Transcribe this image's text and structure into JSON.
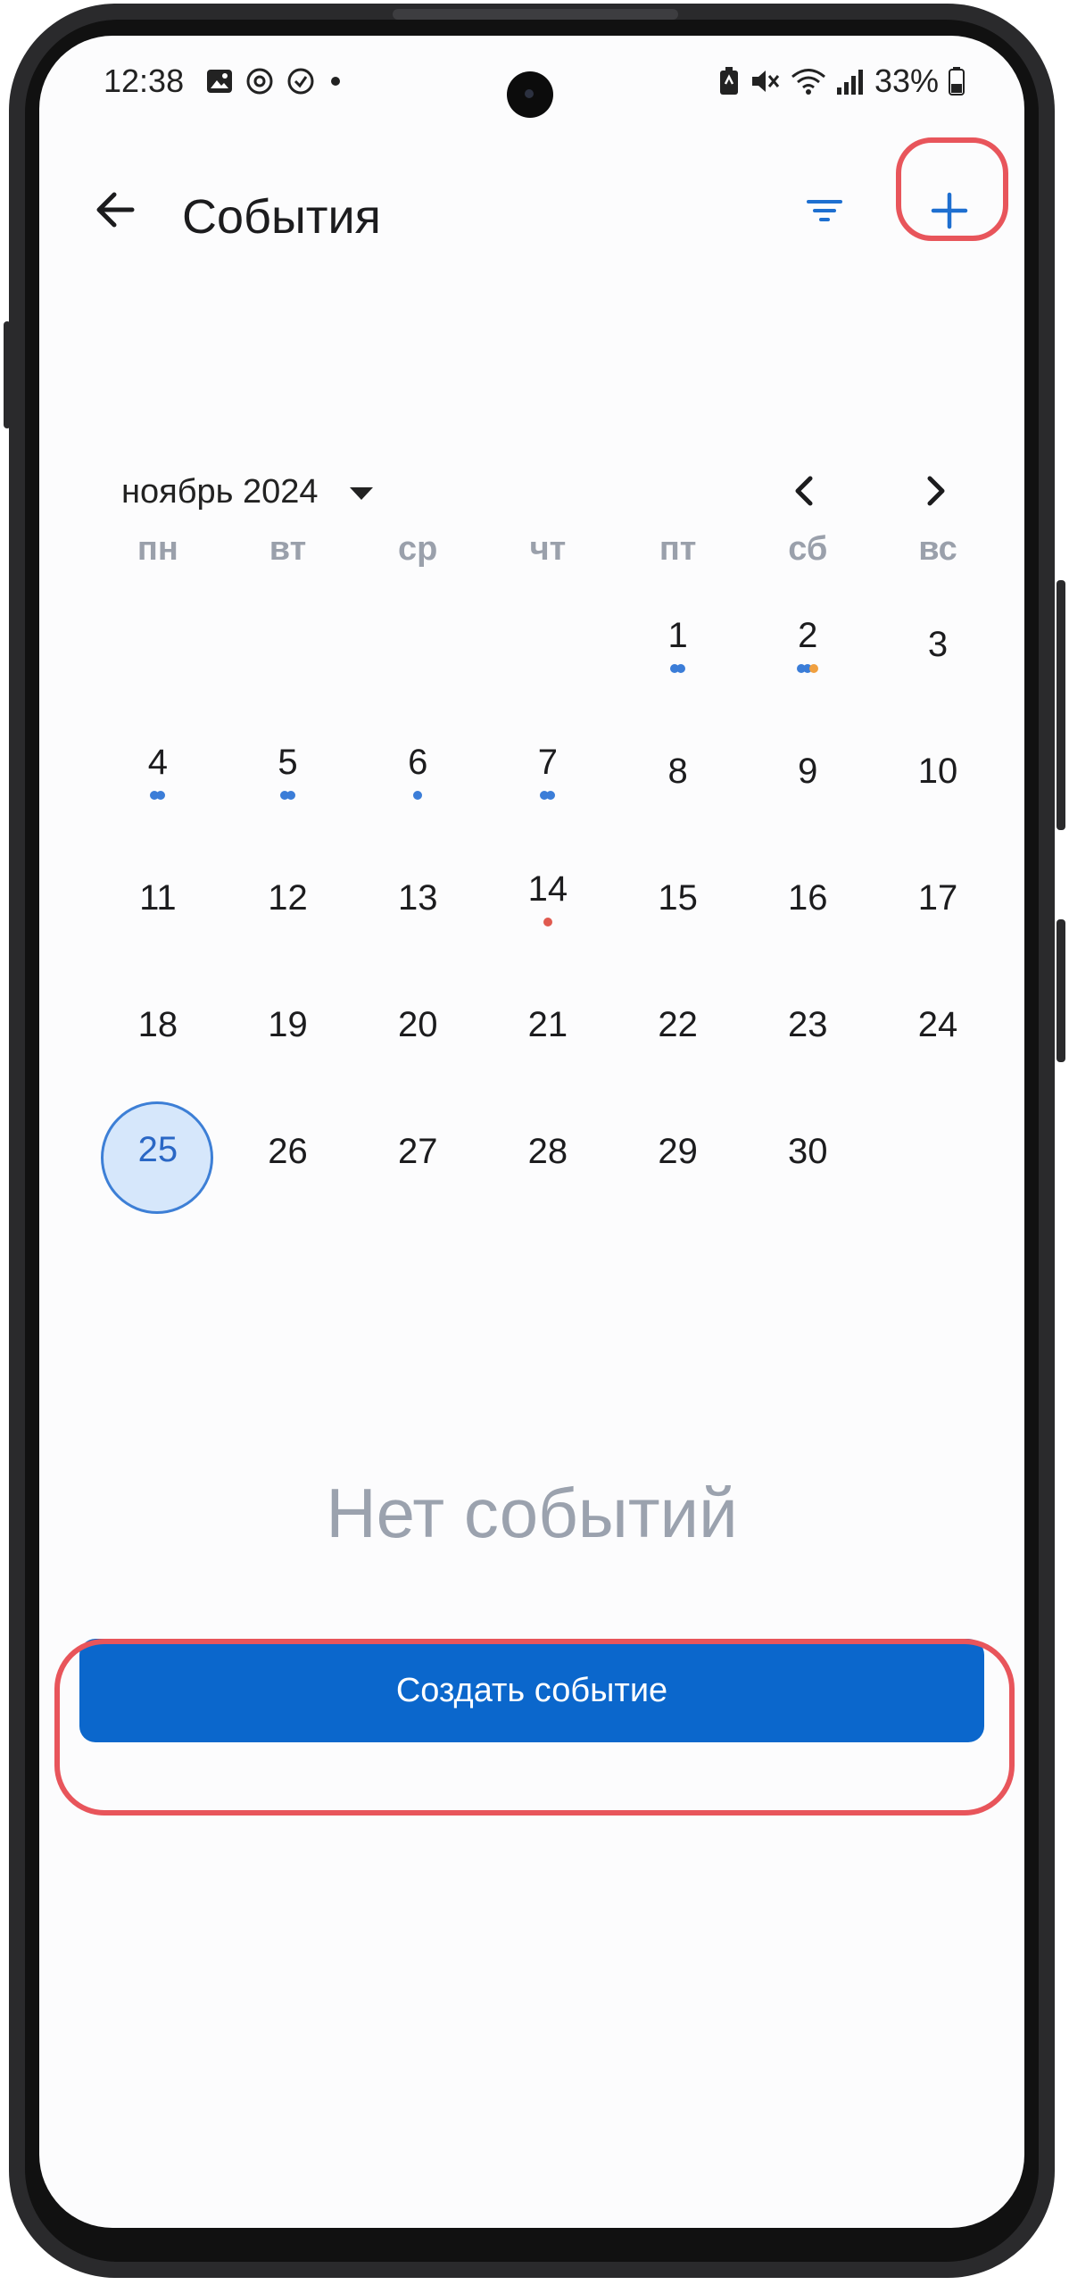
{
  "status_bar": {
    "time": "12:38",
    "battery": "33%",
    "left_icons": [
      "gallery-icon",
      "sync-icon",
      "sync-alt-icon",
      "dot-icon"
    ],
    "right_icons": [
      "battery-saver-icon",
      "mute-icon",
      "wifi-icon",
      "signal-icon",
      "battery-icon"
    ]
  },
  "header": {
    "title": "События",
    "back_icon": "arrow-left-icon",
    "filter_icon": "filter-icon",
    "add_icon": "plus-icon"
  },
  "calendar": {
    "month_label": "ноябрь 2024",
    "weekdays": [
      "пн",
      "вт",
      "ср",
      "чт",
      "пт",
      "сб",
      "вс"
    ],
    "weeks": [
      [
        "",
        "",
        "",
        "",
        "1",
        "2",
        "3"
      ],
      [
        "4",
        "5",
        "6",
        "7",
        "8",
        "9",
        "10"
      ],
      [
        "11",
        "12",
        "13",
        "14",
        "15",
        "16",
        "17"
      ],
      [
        "18",
        "19",
        "20",
        "21",
        "22",
        "23",
        "24"
      ],
      [
        "25",
        "26",
        "27",
        "28",
        "29",
        "30",
        ""
      ]
    ],
    "today": "25",
    "event_dots": {
      "1": [
        "#3b7dd8",
        "#3b7dd8"
      ],
      "2": [
        "#3b7dd8",
        "#3b7dd8",
        "#f0a040"
      ],
      "4": [
        "#3b7dd8",
        "#3b7dd8"
      ],
      "5": [
        "#3b7dd8",
        "#3b7dd8"
      ],
      "6": [
        "#3b7dd8"
      ],
      "7": [
        "#3b7dd8",
        "#3b7dd8"
      ],
      "14": [
        "#e05a4f"
      ]
    }
  },
  "empty_state": {
    "text": "Нет событий",
    "button_label": "Создать событие"
  },
  "colors": {
    "primary": "#0b67cc",
    "highlight": "#e8555b",
    "today_fill": "#d6e7fb"
  }
}
